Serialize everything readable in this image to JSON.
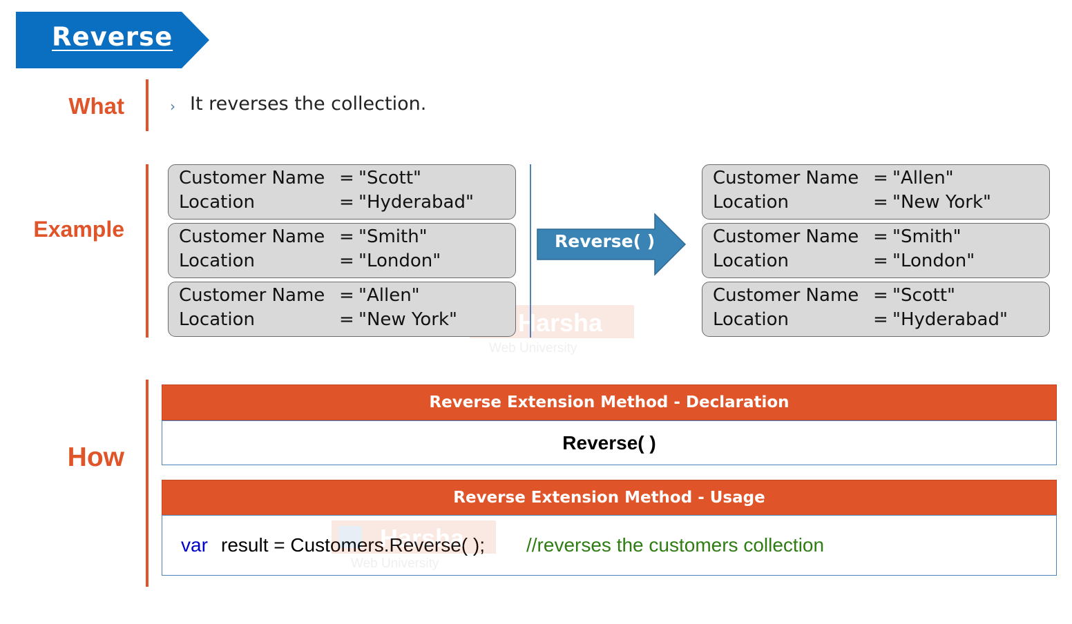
{
  "title": "Reverse",
  "sections": {
    "what": "What",
    "example": "Example",
    "how": "How"
  },
  "what_text": "It reverses the collection.",
  "bullet_icon": "chevron-right-icon",
  "labels": {
    "customer_name": "Customer Name",
    "location": "Location",
    "equals": "="
  },
  "before": [
    {
      "name": "\"Scott\"",
      "location": "\"Hyderabad\""
    },
    {
      "name": "\"Smith\"",
      "location": "\"London\""
    },
    {
      "name": "\"Allen\"",
      "location": "\"New York\""
    }
  ],
  "after": [
    {
      "name": "\"Allen\"",
      "location": "\"New York\""
    },
    {
      "name": "\"Smith\"",
      "location": "\"London\""
    },
    {
      "name": "\"Scott\"",
      "location": "\"Hyderabad\""
    }
  ],
  "arrow_label": "Reverse( )",
  "declaration": {
    "header": "Reverse Extension Method - Declaration",
    "code": "Reverse( )"
  },
  "usage": {
    "header": "Reverse Extension Method - Usage",
    "keyword": "var",
    "code": "result = Customers.Reverse( );",
    "comment": "//reverses the customers collection"
  },
  "watermark": {
    "brand": "Harsha",
    "sub": "Web University"
  },
  "colors": {
    "accent_orange": "#e0542a",
    "banner_blue": "#0b6fc1",
    "arrow_blue": "#3a83b5",
    "keyword_blue": "#0000cc",
    "comment_green": "#2e7d12"
  }
}
